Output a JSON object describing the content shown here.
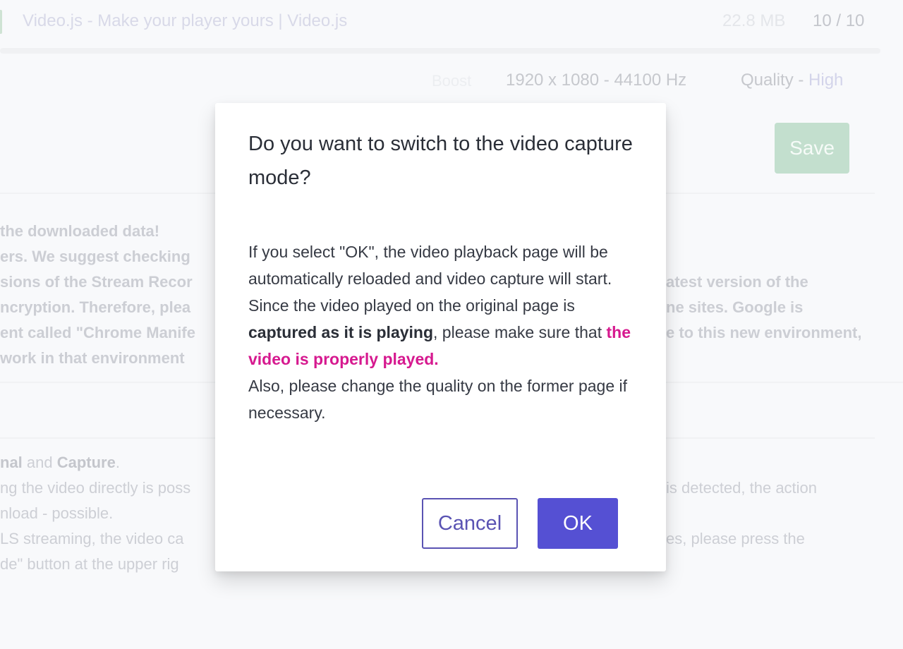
{
  "background": {
    "header": {
      "page_title": "Video.js - Make your player yours | Video.js",
      "file_size": "22.8 MB",
      "count": "10 / 10",
      "progress": 1.0
    },
    "meta": {
      "boost_label": "Boost",
      "resolution": "1920 x 1080 - 44100 Hz",
      "quality_label": "Quality - ",
      "quality_value": "High"
    },
    "save_label": "Save",
    "notice_lines_left": [
      "the downloaded data!",
      "ers. We suggest checking",
      "sions of the Stream Recor",
      "ncryption. Therefore, plea",
      "ent called \"Chrome Manife",
      "work in that environment"
    ],
    "notice_lines_right": [
      "atest version of the",
      "ne sites. Google is",
      "e to this new environment,"
    ],
    "mode_lines_left": {
      "line1_bold1": "nal",
      "line1_mid": " and ",
      "line1_bold2": "Capture",
      "line1_end": ".",
      "line2": "ng the video directly is poss",
      "line3": "nload - possible.",
      "line4": "LS streaming, the video ca",
      "line5": "de\" button at the upper rig"
    },
    "mode_lines_right": {
      "line2": "is detected, the action",
      "line4": "es, please press the"
    }
  },
  "dialog": {
    "title": "Do you want to switch to the video capture mode?",
    "body": {
      "p1": "If you select \"OK\", the video playback page will be automatically reloaded and video capture will start.",
      "p2_start": "Since the video played on the original page is ",
      "p2_bold": "captured as it is playing",
      "p2_mid": ", please make sure that ",
      "p2_highlight": "the video is properly played.",
      "p3": "Also, please change the quality on the former page if necessary."
    },
    "cancel_label": "Cancel",
    "ok_label": "OK"
  },
  "colors": {
    "primary": "#5550d3",
    "highlight": "#d6198f",
    "save_green": "#c3dfce"
  }
}
